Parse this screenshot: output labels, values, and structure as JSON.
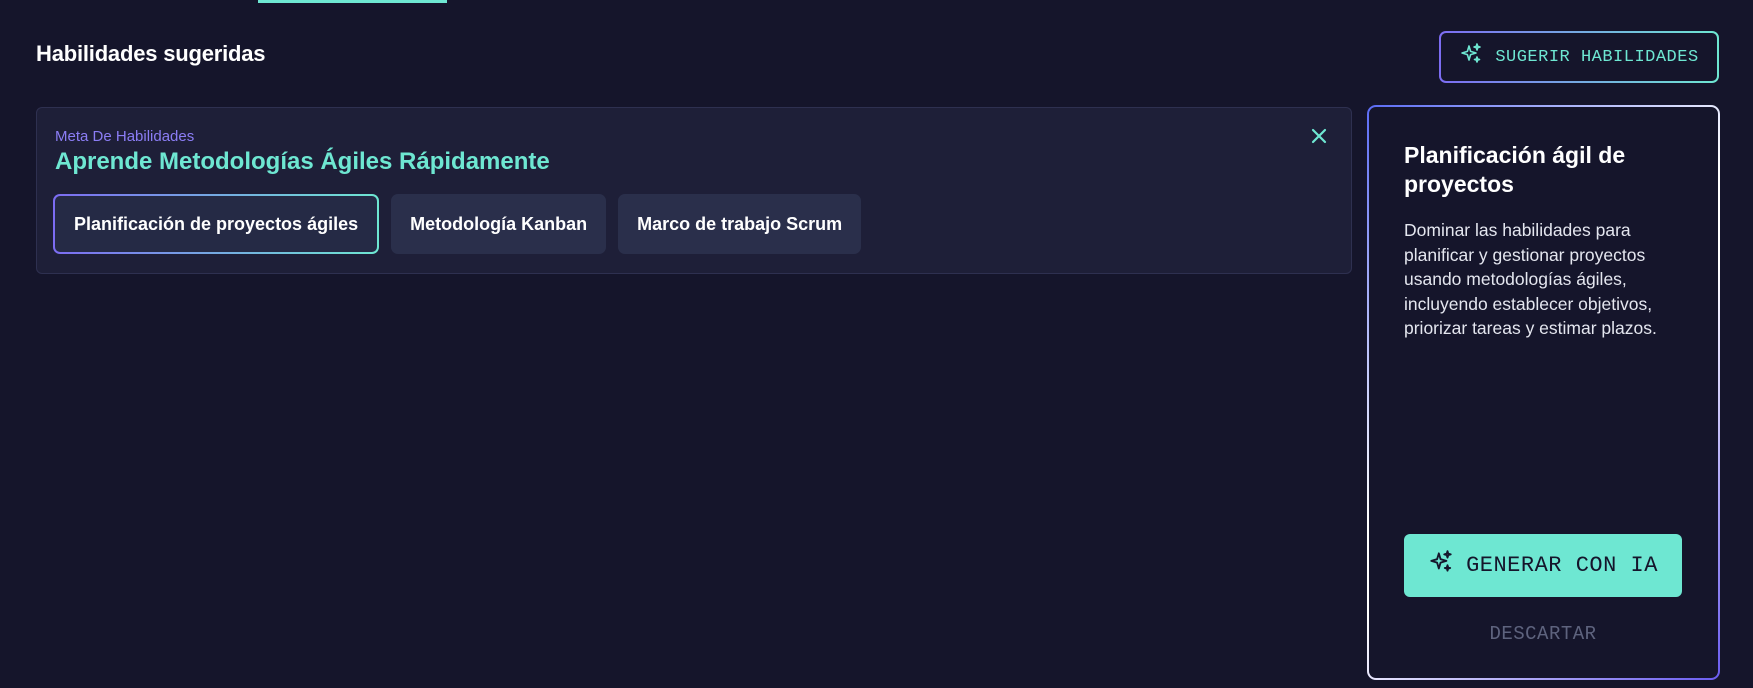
{
  "header": {
    "title": "Habilidades sugeridas",
    "suggest_button_label": "SUGERIR HABILIDADES",
    "suggest_button_icon": "sparkles-icon"
  },
  "goal": {
    "kicker": "Meta De Habilidades",
    "title": "Aprende Metodologías Ágiles Rápidamente",
    "close_icon": "close-icon",
    "skills": [
      {
        "label": "Planificación de proyectos ágiles",
        "selected": true
      },
      {
        "label": "Metodología Kanban",
        "selected": false
      },
      {
        "label": "Marco de trabajo Scrum",
        "selected": false
      }
    ]
  },
  "detail": {
    "title": "Planificación ágil de proyectos",
    "description": "Dominar las habilidades para planificar y gestionar proyectos usando metodologías ágiles, incluyendo establecer objetivos, priorizar tareas y estimar plazos.",
    "generate_button_label": "GENERAR CON IA",
    "generate_button_icon": "sparkles-icon",
    "dismiss_button_label": "DESCARTAR"
  },
  "colors": {
    "background": "#15152b",
    "accent": "#6ee7d2",
    "secondary_accent": "#8b7df5",
    "card": "#1e1f38",
    "chip": "#2a2f4b"
  }
}
